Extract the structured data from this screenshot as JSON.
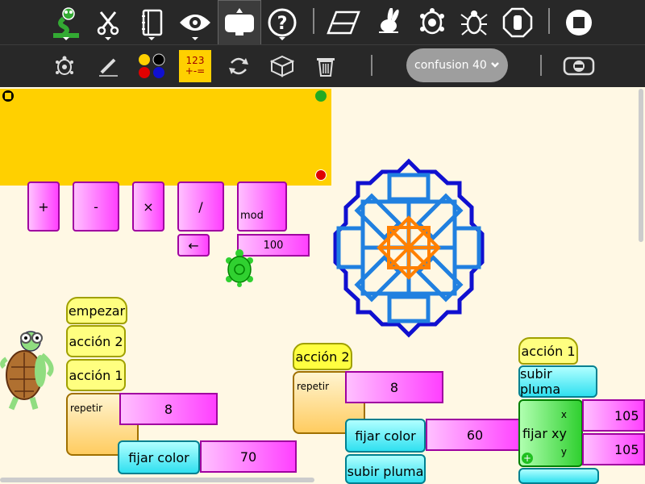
{
  "toolbar": {
    "activity_icon": "turtle-art-icon",
    "edit_icon": "scissors-icon",
    "journal_icon": "notebook-icon",
    "view_icon": "eye-icon",
    "palette_icon": "palette-toggle-icon",
    "help_icon": "help-icon",
    "clean_icon": "eraser-icon",
    "run_fast_icon": "rabbit-icon",
    "run_slow_icon": "turtle-icon",
    "debug_icon": "bug-icon",
    "stop_turtle_icon": "hand-stop-icon",
    "stop_icon": "stop-icon"
  },
  "toolbar2": {
    "turtle_icon": "turtle-palette-icon",
    "pen_icon": "pen-icon",
    "colors_icon": "colors-icon",
    "numbers_label_top": "123",
    "numbers_label_bottom": "+-=",
    "flow_icon": "flow-icon",
    "blocks_icon": "blocks-icon",
    "trash_icon": "trash-icon",
    "combo_value": "confusion 40",
    "hide_icon": "hide-palette-icon"
  },
  "palette": {
    "plus": "+",
    "minus": "-",
    "times": "×",
    "divide": "/",
    "mod": "mod",
    "left_arrow": "←",
    "number": "100"
  },
  "blocks": {
    "start": "empezar",
    "action2": "acción 2",
    "action1": "acción 1",
    "repeat": "repetir",
    "repeat_count_left": "8",
    "set_color": "fijar color",
    "color_left": "70",
    "action2_hat": "acción 2",
    "repeat_mid": "repetir",
    "repeat_count_mid": "8",
    "set_color_mid": "fijar color",
    "color_mid": "60",
    "pen_up_mid": "subir pluma",
    "action1_hat": "acción 1",
    "pen_up_right": "subir pluma",
    "set_xy": "fijar xy",
    "x_label": "x",
    "y_label": "y",
    "x_value": "105",
    "y_value": "105"
  },
  "colors": {
    "toolbar": "#282828",
    "palette": "#ffd000",
    "canvas": "#fff8e4",
    "pattern_outer": "#1010d0",
    "pattern_inner": "#2080e0",
    "pattern_center": "#ff8000",
    "turtle": "#30d030"
  }
}
